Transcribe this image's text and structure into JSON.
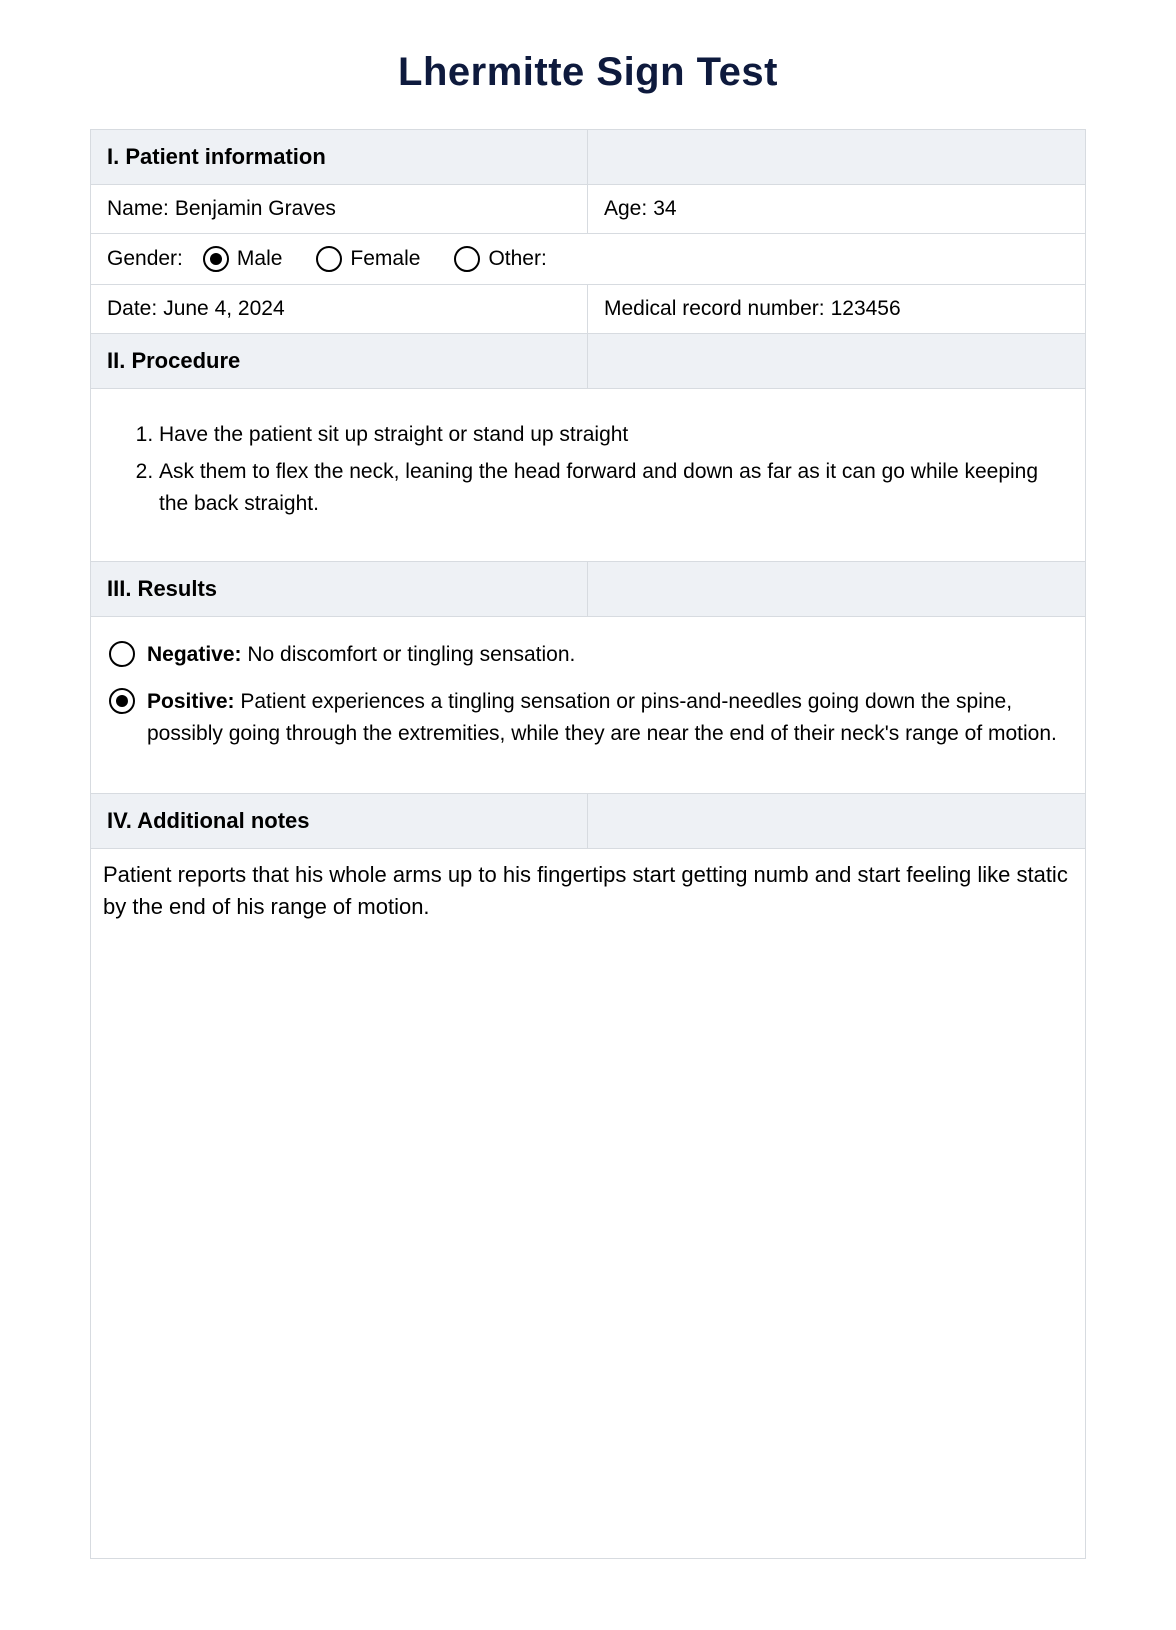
{
  "title": "Lhermitte Sign Test",
  "sections": {
    "patient_info": {
      "heading": "I. Patient information",
      "name_label": "Name:",
      "name_value": "Benjamin Graves",
      "age_label": "Age:",
      "age_value": "34",
      "gender_label": "Gender:",
      "gender_options": {
        "male": "Male",
        "female": "Female",
        "other": "Other:"
      },
      "gender_selected": "male",
      "date_label": "Date:",
      "date_value": "June 4, 2024",
      "mrn_label": "Medical record number:",
      "mrn_value": "123456"
    },
    "procedure": {
      "heading": "II. Procedure",
      "steps": [
        "Have the patient sit up straight or stand up straight",
        "Ask them to flex the neck, leaning the head forward and down as far as it can go while keeping the back straight."
      ]
    },
    "results": {
      "heading": "III. Results",
      "negative_label": "Negative:",
      "negative_desc": "No discomfort or tingling sensation.",
      "positive_label": "Positive:",
      "positive_desc": "Patient experiences a tingling sensation or pins-and-needles going down the spine, possibly going through the extremities, while they are near the end of their neck's range of motion.",
      "selected": "positive"
    },
    "notes": {
      "heading": "IV. Additional notes",
      "text": "Patient reports that his whole arms up to his fingertips start getting numb and start feeling like static by the end of his range of motion."
    }
  }
}
